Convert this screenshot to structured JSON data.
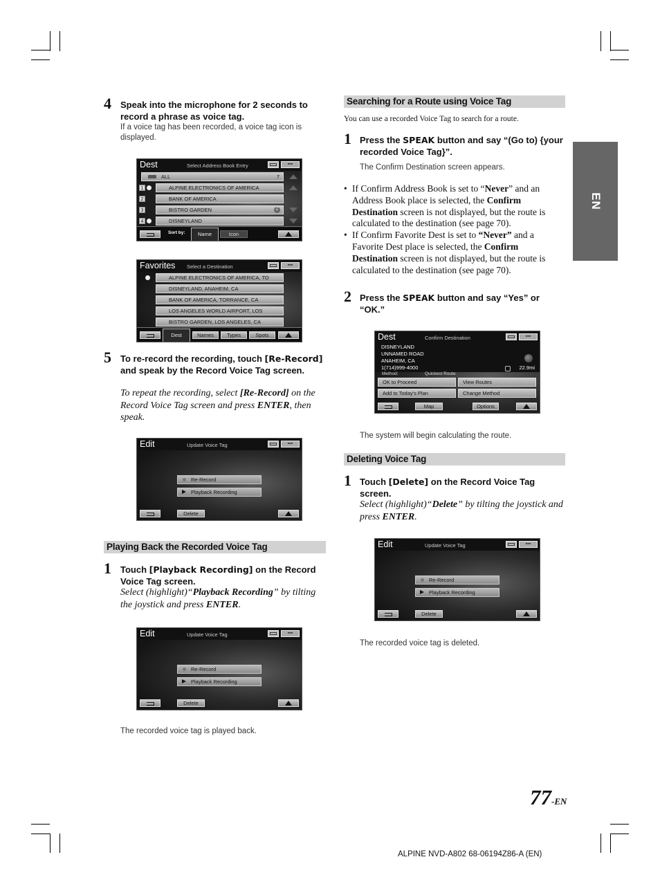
{
  "side_tab": "EN",
  "left": {
    "step4": {
      "number": "4",
      "heading": "Speak into the microphone for 2 seconds to record a phrase as voice tag.",
      "note": "If a voice tag has been recorded, a voice tag icon is displayed."
    },
    "screen_address_book": {
      "title": "Dest",
      "subtitle": "Select Address Book Entry",
      "all_label": "ALL",
      "all_count": "7",
      "rows": [
        {
          "num": "1",
          "label": "ALPINE ELECTRONICS OF AMERICA",
          "voice_tag": true
        },
        {
          "num": "2",
          "label": "BANK OF AMERICA",
          "voice_tag": false
        },
        {
          "num": "3",
          "label": "BISTRO GARDEN",
          "voice_tag": false,
          "badge": "Z"
        },
        {
          "num": "4",
          "label": "DISNEYLAND",
          "voice_tag": true
        }
      ],
      "sort_label": "Sort by:",
      "sort_options": [
        "Name",
        "Icon"
      ],
      "sort_selected": "Name"
    },
    "screen_favorites": {
      "title": "Favorites",
      "subtitle": "Select a Destination",
      "rows": [
        "ALPINE ELECTRONICS OF AMERICA, TO",
        "DISNEYLAND, ANAHEIM, CA",
        "BANK OF AMERICA, TORRANCE, CA",
        "LOS ANGELES WORLD AIRPORT, LOS",
        "BISTRO GARDEN, LOS ANGELES, CA"
      ],
      "tabs": [
        "Dest",
        "Names",
        "Types",
        "Spots"
      ],
      "tab_selected": "Dest"
    },
    "step5": {
      "number": "5",
      "heading_pre": "To re-record the recording, touch ",
      "heading_kw": "[Re-Record]",
      "heading_post": " and speak by the Record Voice Tag screen.",
      "ital_1": "To repeat the recording, select ",
      "ital_b1": "[Re-Record]",
      "ital_2": " on the Record Voice Tag screen and press ",
      "ital_b2": "ENTER",
      "ital_3": ", then speak."
    },
    "screen_edit_1": {
      "title": "Edit",
      "subtitle": "Update Voice Tag",
      "rerecord": "Re-Record",
      "playback": "Playback Recording",
      "delete": "Delete"
    },
    "section_playback": {
      "title": "Playing Back the Recorded Voice Tag",
      "step_number": "1",
      "heading_pre": "Touch ",
      "heading_kw": "[Playback Recording]",
      "heading_post": " on the Record Voice Tag screen.",
      "ital_1": "Select (highlight)“",
      "ital_b1": "Playback Recording",
      "ital_2": "” by tilting the joystick and press ",
      "ital_b2": "ENTER",
      "ital_3": "."
    },
    "screen_edit_2": {
      "title": "Edit",
      "subtitle": "Update Voice Tag",
      "rerecord": "Re-Record",
      "playback": "Playback Recording",
      "delete": "Delete"
    },
    "result_playback": "The recorded voice tag is played back."
  },
  "right": {
    "section_search": {
      "title": "Searching for a Route using Voice Tag",
      "intro": "You can use a recorded Voice Tag to search for a route.",
      "step1_number": "1",
      "step1_pre": "Press the ",
      "step1_kw": "SPEAK",
      "step1_post": " button and say “(Go to) {your recorded Voice Tag}”.",
      "step1_note": "The Confirm Destination screen appears.",
      "bullets": [
        {
          "p1": "If Confirm Address Book is set to “",
          "b1": "Never",
          "p2": "” and an Address Book place is selected, the ",
          "b2": "Confirm Destination",
          "p3": " screen is not displayed, but the route is calculated to the destination (see page 70)."
        },
        {
          "p1": "If Confirm Favorite Dest is set to ",
          "b1": "“Never”",
          "p2": " and a Favorite Dest place is selected, the ",
          "b2": "Confirm Destination",
          "p3": " screen is not displayed, but the route is calculated to the destination (see page 70)."
        }
      ],
      "step2_number": "2",
      "step2_pre": "Press the ",
      "step2_kw": "SPEAK",
      "step2_post": " button and say “Yes” or “OK.”"
    },
    "screen_confirm": {
      "title": "Dest",
      "subtitle": "Confirm Destination",
      "address": [
        "DISNEYLAND",
        "UNNAMED ROAD",
        "ANAHEIM, CA",
        "1(714)999-4000"
      ],
      "distance": "22.9mi",
      "method_label": "Method:",
      "method_value": "Quickest Route",
      "buttons": [
        "OK to Proceed",
        "View Routes",
        "Add to Today's Plan",
        "Change Method"
      ],
      "bottom": [
        "Map",
        "Options"
      ]
    },
    "result_calc": "The system will begin calculating the route.",
    "section_delete": {
      "title": "Deleting Voice Tag",
      "step_number": "1",
      "heading_pre": "Touch ",
      "heading_kw": "[Delete]",
      "heading_post": " on the Record Voice Tag screen.",
      "ital_1": "Select (highlight)“",
      "ital_b1": "Delete",
      "ital_2": "” by tilting the joystick and press ",
      "ital_b2": "ENTER",
      "ital_3": "."
    },
    "screen_edit_3": {
      "title": "Edit",
      "subtitle": "Update Voice Tag",
      "rerecord": "Re-Record",
      "playback": "Playback Recording",
      "delete": "Delete"
    },
    "result_delete": "The recorded voice tag is deleted."
  },
  "page_number": "77",
  "page_suffix": "-EN",
  "footer": "ALPINE NVD-A802 68-06194Z86-A (EN)"
}
